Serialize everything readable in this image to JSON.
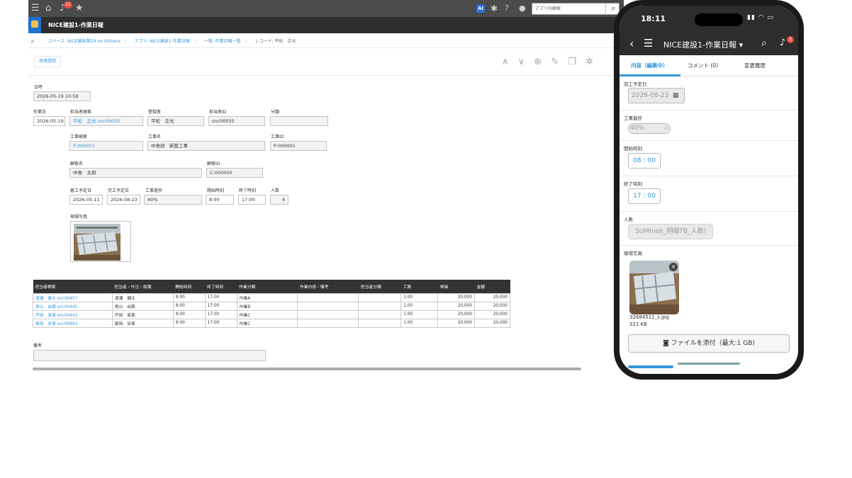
{
  "topbar": {
    "notif_count": "12",
    "ai_label": "AI",
    "search_placeholder": "アプリ内検索",
    "icons": [
      "menu-icon",
      "home-icon",
      "bell-icon",
      "star-icon",
      "gear-icon",
      "help-icon",
      "user-icon",
      "search-icon"
    ]
  },
  "app": {
    "title": "NICE建設1-作業日報"
  },
  "breadcrumb": {
    "home": "⌂",
    "space": "スペース: NICE建設業DX on kintone",
    "app": "アプリ: NICE建設1-作業日報",
    "list": "一覧: 作業日報一覧",
    "record": "レコード: 平松　正光"
  },
  "toolbar": {
    "extra_button": "原価登録"
  },
  "record": {
    "nichiji_label": "日時",
    "nichiji": "2026-05-19 10:58",
    "sagyobi_label": "作業日",
    "sagyobi": "2026-05-19",
    "tanto_search_label": "担当者検索",
    "tanto_search": "平松　正光 snc00035",
    "toroku_label": "登録者",
    "toroku": "平松　正光",
    "tanto_id_label": "担当者ID",
    "tanto_id": "snc00035",
    "bunrui_label": "分類",
    "bunrui": "",
    "koji_search_label": "工事検索",
    "koji_search": "P-000001",
    "koji_name_label": "工事名",
    "koji_name": "中島邸　新築工事",
    "koji_id_label": "工事ID",
    "koji_id": "P-000001",
    "kokyaku_label": "顧客名",
    "kokyaku": "中島　太郎",
    "kokyaku_id_label": "顧客ID",
    "kokyaku_id": "C-000050",
    "chako_label": "着工予定日",
    "chako": "2026-05-11",
    "kanko_label": "完工予定日",
    "kanko": "2026-08-23",
    "shincho_label": "工事進捗",
    "shincho": "40%",
    "start_label": "開始時刻",
    "start": "8:00",
    "end_label": "終了時刻",
    "end": "17:00",
    "ninzu_label": "人数",
    "ninzu": "4",
    "photo_label": "現場写真",
    "biko_label": "備考"
  },
  "table": {
    "headers": [
      "担当者検索",
      "担当者・外注・設備",
      "開始時刻",
      "終了時刻",
      "作業分類",
      "作業内容・備考",
      "担当者分類",
      "工数",
      "単価",
      "金額"
    ],
    "rows": [
      [
        "渡瀬　健太 snc00457",
        "渡瀬　健太",
        "8:00",
        "17:00",
        "作業A",
        "",
        "",
        "1.00",
        "20,000",
        "20,000"
      ],
      [
        "男山　由美 snc00445",
        "男山　由美",
        "8:00",
        "17:00",
        "作業B",
        "",
        "",
        "1.00",
        "20,000",
        "20,000"
      ],
      [
        "芦田　英美 snc00443",
        "芦田　英美",
        "8:00",
        "17:00",
        "作業C",
        "",
        "",
        "1.00",
        "20,000",
        "20,000"
      ],
      [
        "飯田　歩美 snc99993",
        "飯田　歩美",
        "8:00",
        "17:00",
        "作業C",
        "",
        "",
        "1.00",
        "20,000",
        "20,000"
      ]
    ]
  },
  "phone": {
    "time": "18:11",
    "nav_title": "NICE建設1-作業日報 ▾",
    "notif_count": "3",
    "tabs": [
      "内容（編集中）",
      "コメント (0)",
      "変更履歴"
    ],
    "kanko_label": "完工予定日",
    "kanko": "2026-08-23",
    "shincho_label": "工事進捗",
    "shincho": "40%",
    "start_label": "開始時刻",
    "start": "08 : 00",
    "end_label": "終了時刻",
    "end": "17 : 00",
    "ninzu_label": "人数",
    "ninzu": "SUM(nok_明細TB_人数)",
    "photo_label": "現場写真",
    "file_name": "32684511_s.jpg",
    "file_size": "321 KB",
    "attach_label": "ファイルを添付（最大:1 GB)"
  },
  "colors": {
    "topbar": "#4b4b4b",
    "appbar": "#2e2e2e",
    "link": "#3498db",
    "table_header": "#333333",
    "badge": "#e74c3c"
  }
}
